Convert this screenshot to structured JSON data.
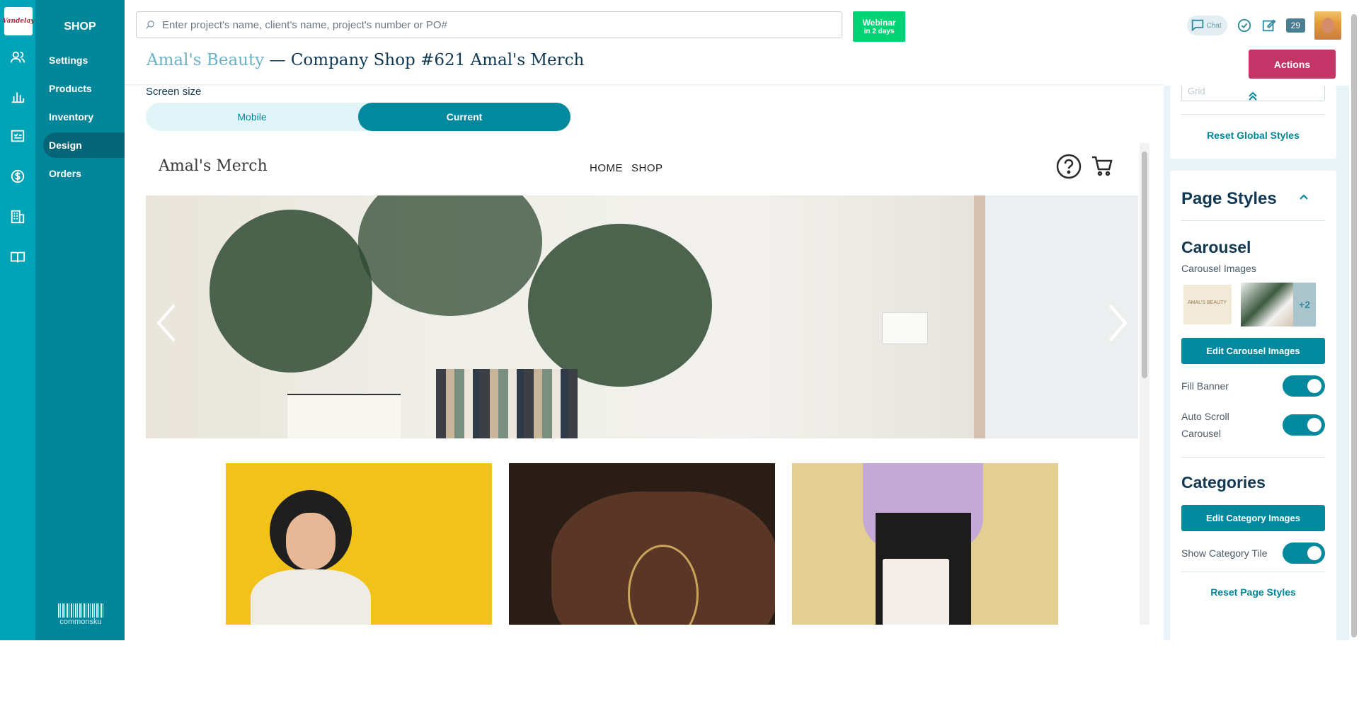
{
  "app": {
    "logo_text": "Vandelay",
    "section_title": "SHOP",
    "nav": [
      {
        "label": "Settings"
      },
      {
        "label": "Products"
      },
      {
        "label": "Inventory"
      },
      {
        "label": "Design"
      },
      {
        "label": "Orders"
      }
    ],
    "footer_brand": "commonsku"
  },
  "header": {
    "search_placeholder": "Enter project's name, client's name, project's number or PO#",
    "webinar_line1": "Webinar",
    "webinar_line2": "in 2 days",
    "chat_label": "Chat",
    "notifications_count": "29"
  },
  "page": {
    "client": "Amal's Beauty",
    "separator": " — ",
    "title": "Company Shop #621 Amal's Merch",
    "actions_label": "Actions"
  },
  "preview": {
    "screen_size_label": "Screen size",
    "mobile_label": "Mobile",
    "current_label": "Current",
    "shop_name": "Amal's Merch",
    "nav_home": "HOME",
    "nav_shop": "SHOP"
  },
  "right_panel": {
    "grid_select_value": "Grid",
    "reset_global": "Reset Global Styles",
    "page_styles_title": "Page Styles",
    "carousel_title": "Carousel",
    "carousel_images_label": "Carousel Images",
    "thumb_text": "AMAL'S BEAUTY",
    "more_images": "+2",
    "edit_carousel": "Edit Carousel Images",
    "fill_banner": "Fill Banner",
    "auto_scroll_1": "Auto Scroll",
    "auto_scroll_2": "Carousel",
    "categories_title": "Categories",
    "edit_category": "Edit Category Images",
    "show_category_tile": "Show Category Tile",
    "reset_page": "Reset Page Styles",
    "fill_banner_on": true,
    "auto_scroll_on": true,
    "show_category_tile_on": true
  },
  "colors": {
    "rail": "#01a4b6",
    "sidenav": "#02879a",
    "primary": "#02899d",
    "actions": "#c23566",
    "webinar": "#00d374"
  }
}
